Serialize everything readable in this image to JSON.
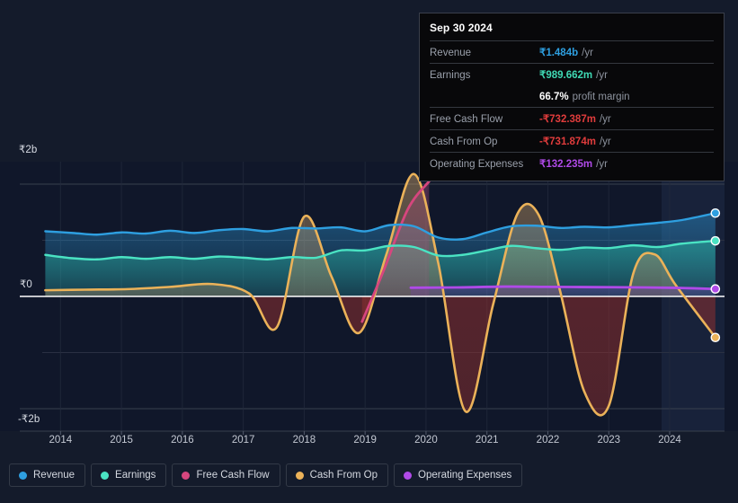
{
  "chart_data": {
    "type": "area",
    "title": "",
    "xlabel": "",
    "ylabel": "",
    "currency_symbol": "₹",
    "x_ticks": [
      "2014",
      "2015",
      "2016",
      "2017",
      "2018",
      "2019",
      "2020",
      "2021",
      "2022",
      "2023",
      "2024"
    ],
    "y_ticks": [
      "₹2b",
      "₹0",
      "-₹2b"
    ],
    "y_tick_values": [
      2000000000,
      0,
      -2000000000
    ],
    "ylim": [
      -2400000000,
      2400000000
    ],
    "xlim": [
      2013.7,
      2024.9
    ],
    "grid": true,
    "legend_position": "bottom",
    "series": [
      {
        "name": "Revenue",
        "color": "#2e9fe0",
        "x": [
          2013.75,
          2014.2,
          2014.6,
          2015.0,
          2015.4,
          2015.8,
          2016.2,
          2016.6,
          2017.0,
          2017.4,
          2017.8,
          2018.2,
          2018.6,
          2019.0,
          2019.4,
          2019.8,
          2020.2,
          2020.6,
          2021.0,
          2021.4,
          2021.8,
          2022.2,
          2022.6,
          2023.0,
          2023.4,
          2023.8,
          2024.2,
          2024.75
        ],
        "values": [
          1.16,
          1.13,
          1.1,
          1.14,
          1.12,
          1.17,
          1.13,
          1.18,
          1.2,
          1.16,
          1.22,
          1.21,
          1.23,
          1.16,
          1.27,
          1.25,
          1.05,
          1.02,
          1.14,
          1.25,
          1.26,
          1.22,
          1.24,
          1.23,
          1.27,
          1.31,
          1.36,
          1.484
        ],
        "unit": "b"
      },
      {
        "name": "Earnings",
        "color": "#4ae3c3",
        "x": [
          2013.75,
          2014.2,
          2014.6,
          2015.0,
          2015.4,
          2015.8,
          2016.2,
          2016.6,
          2017.0,
          2017.4,
          2017.8,
          2018.2,
          2018.6,
          2019.0,
          2019.4,
          2019.8,
          2020.2,
          2020.6,
          2021.0,
          2021.4,
          2021.8,
          2022.2,
          2022.6,
          2023.0,
          2023.4,
          2023.8,
          2024.2,
          2024.75
        ],
        "values": [
          0.74,
          0.68,
          0.66,
          0.7,
          0.67,
          0.7,
          0.67,
          0.71,
          0.69,
          0.66,
          0.7,
          0.69,
          0.82,
          0.82,
          0.9,
          0.88,
          0.73,
          0.74,
          0.82,
          0.9,
          0.86,
          0.83,
          0.87,
          0.86,
          0.91,
          0.88,
          0.94,
          0.9897
        ],
        "unit": "b"
      },
      {
        "name": "Free Cash Flow",
        "color": "#d6467e",
        "x": [
          2018.95,
          2019.3,
          2019.7,
          2020.05
        ],
        "values": [
          -0.45,
          0.45,
          1.55,
          2.05
        ],
        "unit": "b"
      },
      {
        "name": "Cash From Op",
        "color": "#ebb259",
        "x": [
          2013.75,
          2014.4,
          2015.1,
          2015.8,
          2016.5,
          2017.1,
          2017.55,
          2018.0,
          2018.45,
          2018.9,
          2019.35,
          2019.8,
          2020.2,
          2020.65,
          2021.1,
          2021.5,
          2021.85,
          2022.2,
          2022.6,
          2023.0,
          2023.4,
          2023.75,
          2024.1,
          2024.75
        ],
        "values": [
          0.11,
          0.12,
          0.13,
          0.17,
          0.22,
          0.05,
          -0.55,
          1.42,
          0.35,
          -0.65,
          0.75,
          2.18,
          0.6,
          -2.05,
          -0.15,
          1.47,
          1.45,
          0.1,
          -1.7,
          -1.95,
          0.4,
          0.75,
          0.2,
          -0.7319
        ],
        "unit": "b"
      },
      {
        "name": "Operating Expenses",
        "color": "#b04ae8",
        "x": [
          2019.75,
          2020.5,
          2021.3,
          2022.0,
          2022.8,
          2023.6,
          2024.2,
          2024.75
        ],
        "values": [
          0.155,
          0.16,
          0.175,
          0.17,
          0.165,
          0.16,
          0.15,
          0.1322
        ],
        "unit": "b"
      }
    ]
  },
  "tooltip": {
    "date": "Sep 30 2024",
    "rows": [
      {
        "label": "Revenue",
        "value": "₹1.484b",
        "unit": "/yr",
        "color": "#2e9fe0"
      },
      {
        "label": "Earnings",
        "value": "₹989.662m",
        "unit": "/yr",
        "color": "#3fd9b4"
      },
      {
        "label": "",
        "value": "66.7%",
        "unit": "profit margin",
        "color": "#ffffff"
      },
      {
        "label": "Free Cash Flow",
        "value": "-₹732.387m",
        "unit": "/yr",
        "color": "#e03c3c"
      },
      {
        "label": "Cash From Op",
        "value": "-₹731.874m",
        "unit": "/yr",
        "color": "#e03c3c"
      },
      {
        "label": "Operating Expenses",
        "value": "₹132.235m",
        "unit": "/yr",
        "color": "#b04ae8"
      }
    ]
  },
  "legend": {
    "items": [
      {
        "label": "Revenue",
        "color": "#2e9fe0"
      },
      {
        "label": "Earnings",
        "color": "#4ae3c3"
      },
      {
        "label": "Free Cash Flow",
        "color": "#d6467e"
      },
      {
        "label": "Cash From Op",
        "color": "#ebb259"
      },
      {
        "label": "Operating Expenses",
        "color": "#b04ae8"
      }
    ]
  },
  "axis": {
    "y_top": "₹2b",
    "y_mid": "₹0",
    "y_bottom": "-₹2b"
  }
}
